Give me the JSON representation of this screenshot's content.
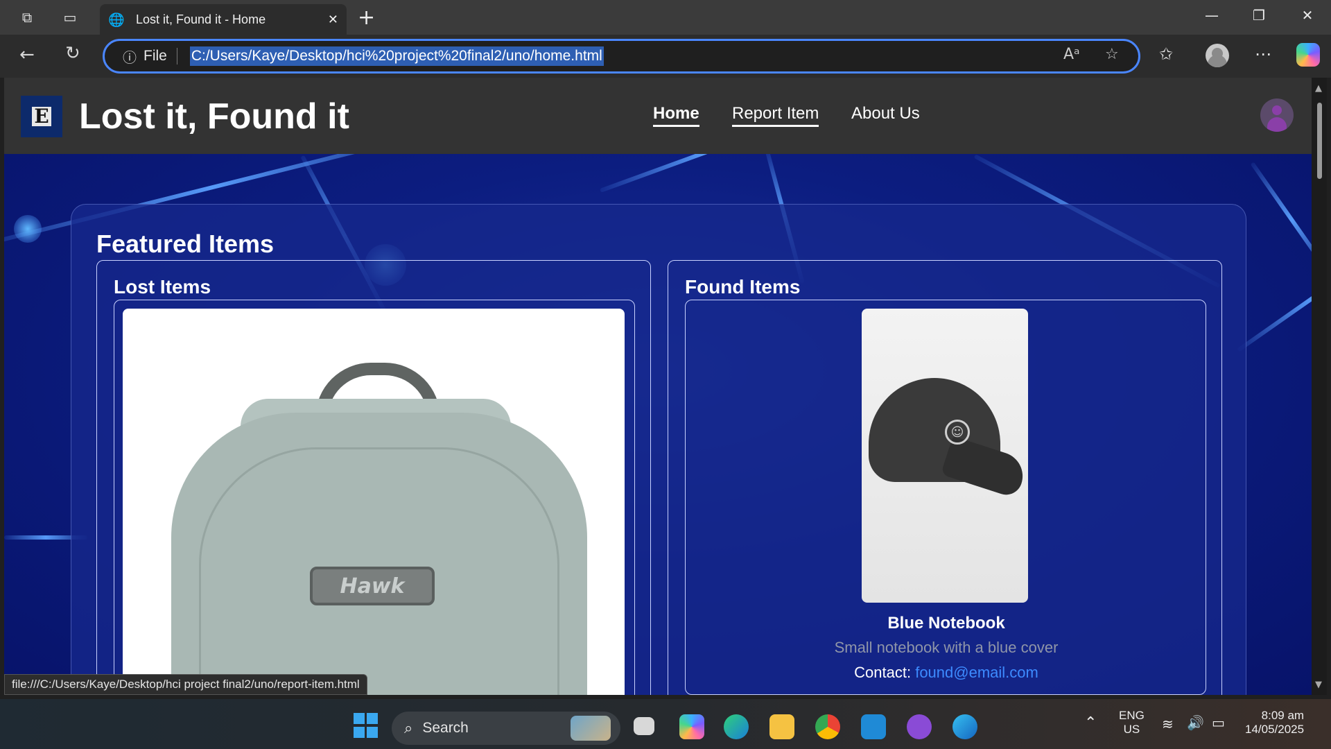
{
  "browser": {
    "tab_title": "Lost it, Found it - Home",
    "url_prefix": "File",
    "url": "C:/Users/Kaye/Desktop/hci%20project%20final2/uno/home.html",
    "status_url": "file:///C:/Users/Kaye/Desktop/hci project final2/uno/report-item.html"
  },
  "site": {
    "title": "Lost it, Found it",
    "nav": [
      "Home",
      "Report Item",
      "About Us"
    ]
  },
  "featured": {
    "title": "Featured Items",
    "lost": {
      "heading": "Lost Items",
      "image_label": "Hawk"
    },
    "found": {
      "heading": "Found Items",
      "item_name": "Blue Notebook",
      "item_desc": "Small notebook with a blue cover",
      "contact_label": "Contact:",
      "contact_email": "found@email.com"
    }
  },
  "taskbar": {
    "search_placeholder": "Search",
    "lang_top": "ENG",
    "lang_bottom": "US",
    "time": "8:09 am",
    "date": "14/05/2025"
  },
  "colors": {
    "accent": "#4a86ff",
    "header_bg": "#333333",
    "hero_bg": "#0c1d80",
    "link": "#3d8bff"
  }
}
